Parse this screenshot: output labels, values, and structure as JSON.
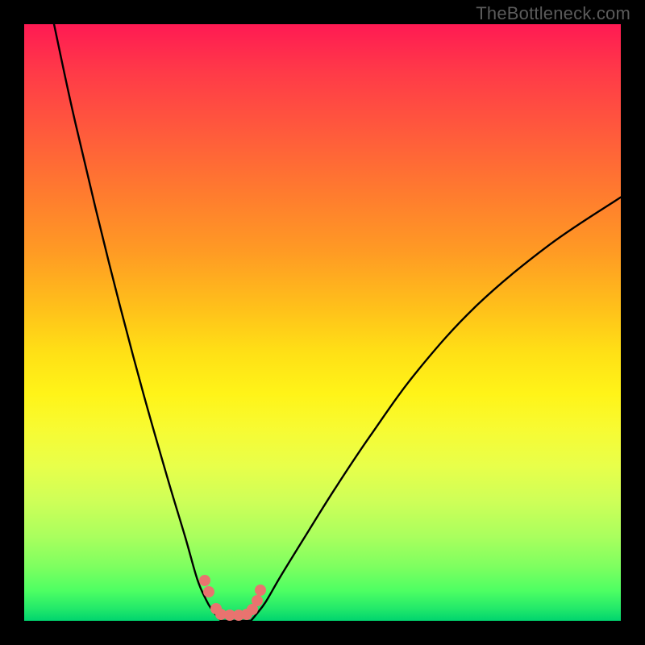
{
  "watermark": "TheBottleneck.com",
  "chart_data": {
    "type": "line",
    "title": "",
    "xlabel": "",
    "ylabel": "",
    "xlim": [
      0,
      100
    ],
    "ylim": [
      0,
      100
    ],
    "background_gradient": {
      "direction": "vertical",
      "stops": [
        {
          "pos": 0,
          "color": "#ff1a53"
        },
        {
          "pos": 18,
          "color": "#ff5a3c"
        },
        {
          "pos": 38,
          "color": "#ff9a24"
        },
        {
          "pos": 55,
          "color": "#ffe016"
        },
        {
          "pos": 74,
          "color": "#e8ff4a"
        },
        {
          "pos": 91,
          "color": "#7dff60"
        },
        {
          "pos": 100,
          "color": "#00d46e"
        }
      ]
    },
    "series": [
      {
        "name": "left-branch",
        "x": [
          5,
          8,
          12,
          16,
          20,
          24,
          27,
          29,
          30.5,
          31.5,
          32.3,
          33
        ],
        "y": [
          100,
          86,
          69,
          53,
          38,
          24,
          14,
          7,
          3.5,
          1.8,
          0.8,
          0
        ]
      },
      {
        "name": "right-branch",
        "x": [
          38,
          39,
          40.5,
          43,
          47,
          52,
          58,
          66,
          76,
          88,
          100
        ],
        "y": [
          0,
          1.2,
          3.2,
          7.5,
          14,
          22,
          31,
          42,
          53,
          63,
          71
        ]
      },
      {
        "name": "valley-floor",
        "x": [
          33,
          35.5,
          38
        ],
        "y": [
          0,
          0,
          0
        ]
      }
    ],
    "markers": [
      {
        "x": 30.3,
        "y": 6.8
      },
      {
        "x": 30.9,
        "y": 4.9
      },
      {
        "x": 32.1,
        "y": 2.0
      },
      {
        "x": 33.0,
        "y": 1.1
      },
      {
        "x": 34.5,
        "y": 0.95
      },
      {
        "x": 36.0,
        "y": 0.95
      },
      {
        "x": 37.3,
        "y": 1.05
      },
      {
        "x": 38.3,
        "y": 1.9
      },
      {
        "x": 39.0,
        "y": 3.4
      },
      {
        "x": 39.6,
        "y": 5.1
      }
    ],
    "marker_color": "#e9736f",
    "curve_color": "#000000"
  }
}
